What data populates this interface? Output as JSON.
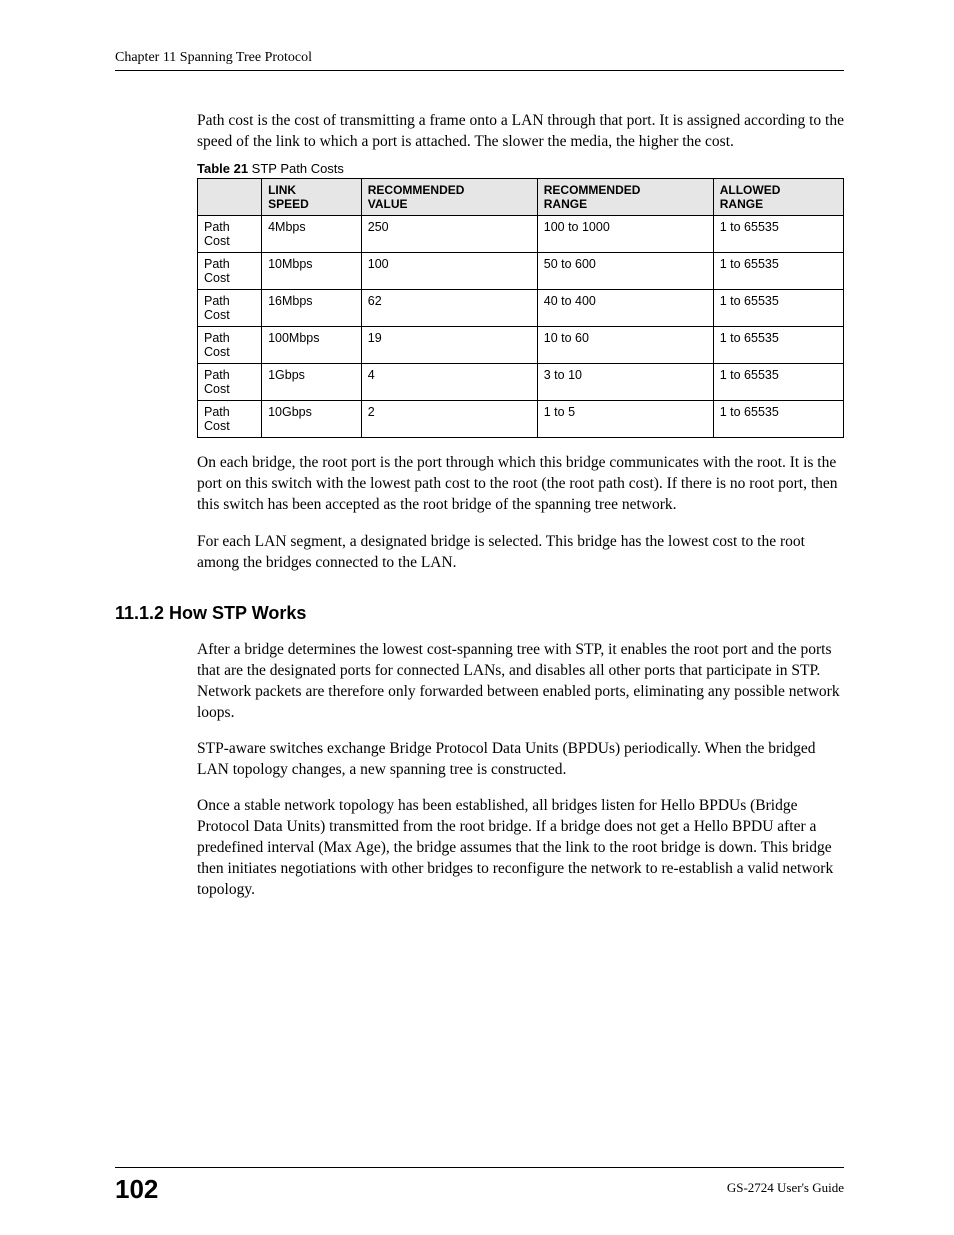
{
  "header": {
    "chapter_line": "Chapter 11 Spanning Tree Protocol"
  },
  "para_intro": "Path cost is the cost of transmitting a frame onto a LAN through that port. It is assigned according to the speed of the link to which a port is attached. The slower the media, the higher the cost.",
  "table": {
    "caption_bold": "Table 21",
    "caption_rest": "   STP Path Costs",
    "headers": {
      "c0": "",
      "c1_a": "LINK",
      "c1_b": "SPEED",
      "c2_a": "RECOMMENDED",
      "c2_b": "VALUE",
      "c3_a": "RECOMMENDED",
      "c3_b": "RANGE",
      "c4_a": "ALLOWED",
      "c4_b": "RANGE"
    },
    "rowlabel_a": "Path",
    "rowlabel_b": "Cost",
    "rows": [
      {
        "link_speed": "4Mbps",
        "rec_value": "250",
        "rec_range": "100 to 1000",
        "allowed_range": "1 to 65535"
      },
      {
        "link_speed": "10Mbps",
        "rec_value": "100",
        "rec_range": "50 to 600",
        "allowed_range": "1 to 65535"
      },
      {
        "link_speed": "16Mbps",
        "rec_value": "62",
        "rec_range": "40 to 400",
        "allowed_range": "1 to 65535"
      },
      {
        "link_speed": "100Mbps",
        "rec_value": "19",
        "rec_range": "10 to 60",
        "allowed_range": "1 to 65535"
      },
      {
        "link_speed": "1Gbps",
        "rec_value": "4",
        "rec_range": "3 to 10",
        "allowed_range": "1 to 65535"
      },
      {
        "link_speed": "10Gbps",
        "rec_value": "2",
        "rec_range": "1 to 5",
        "allowed_range": "1 to 65535"
      }
    ]
  },
  "para_after1": "On each bridge, the root port is the port through which this bridge communicates with the root. It is the port on this switch with the lowest path cost to the root (the root path cost). If there is no root port, then this switch has been accepted as the root bridge of the spanning tree network.",
  "para_after2": "For each LAN segment, a designated bridge is selected. This bridge has the lowest cost to the root among the bridges connected to the LAN.",
  "section": {
    "title": "11.1.2  How STP Works",
    "p1": "After a bridge determines the lowest cost-spanning tree with STP, it enables the root port and the ports that are the designated ports for connected LANs, and disables all other ports that participate in STP. Network packets are therefore only forwarded between enabled ports, eliminating any possible network loops.",
    "p2": "STP-aware switches exchange Bridge Protocol Data Units (BPDUs) periodically. When the bridged LAN topology changes, a new spanning tree is constructed.",
    "p3": "Once a stable network topology has been established, all bridges listen for Hello BPDUs (Bridge Protocol Data Units) transmitted from the root bridge. If a bridge does not get a Hello BPDU after a predefined interval (Max Age), the bridge assumes that the link to the root bridge is down. This bridge then initiates negotiations with other bridges to reconfigure the network to re-establish a valid network topology."
  },
  "footer": {
    "page_number": "102",
    "guide": "GS-2724 User's Guide"
  }
}
